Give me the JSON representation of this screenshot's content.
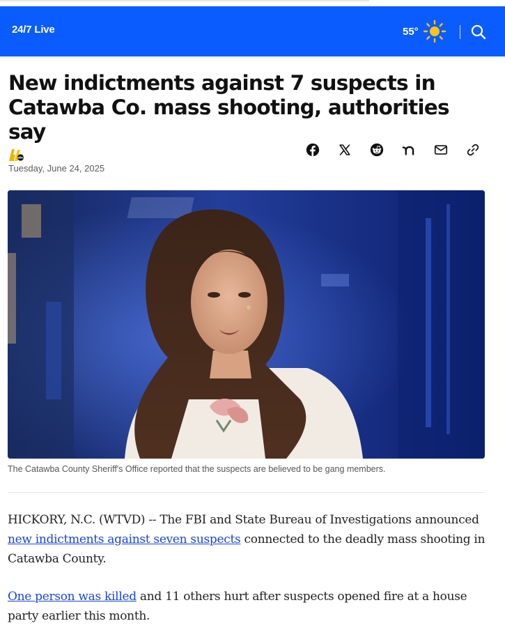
{
  "topbar": {
    "live_label": "24/7 Live",
    "temperature": "55°",
    "weather_icon": "sun-icon",
    "search_icon": "search-icon",
    "bar_color": "#0a5cff"
  },
  "article": {
    "headline": "New indictments against 7 suspects in Catawba Co. mass shooting, authorities say",
    "station_logo": "abc11-logo",
    "date": "Tuesday, June 24, 2025",
    "share_icons": [
      "facebook-icon",
      "x-icon",
      "reddit-icon",
      "nextdoor-icon",
      "email-icon",
      "link-icon"
    ],
    "video_caption": "The Catawba County Sheriff's Office reported that the suspects are believed to be gang members.",
    "paragraph1": {
      "lead": "HICKORY, N.C. (WTVD) -- The FBI and State Bureau of Investigations announced ",
      "link": "new indictments against seven suspects",
      "tail": " connected to the deadly mass shooting in Catawba County."
    },
    "paragraph2": {
      "link": "One person was killed",
      "tail": " and 11 others hurt after suspects opened fire at a house party earlier this month."
    },
    "link_color": "#1747d6"
  }
}
